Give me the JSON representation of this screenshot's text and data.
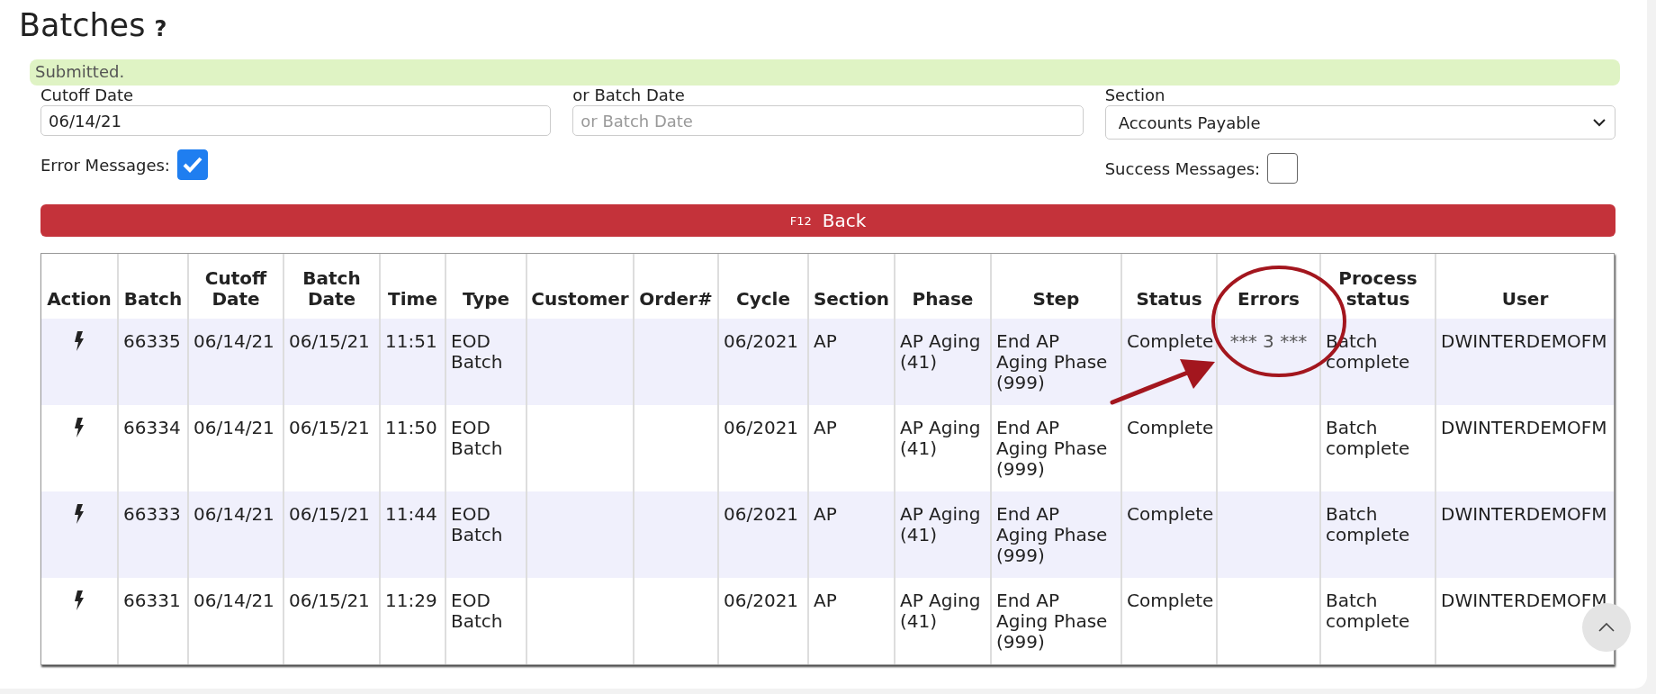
{
  "page": {
    "title": "Batches",
    "help": "?"
  },
  "notice": "Submitted.",
  "filters": {
    "cutoff_date": {
      "label": "Cutoff Date",
      "value": "06/14/21"
    },
    "batch_date": {
      "label": "or Batch Date",
      "placeholder": "or Batch Date"
    },
    "section": {
      "label": "Section",
      "value": "Accounts Payable"
    },
    "error_messages": {
      "label": "Error Messages:",
      "checked": true
    },
    "success_messages": {
      "label": "Success Messages:",
      "checked": false
    }
  },
  "back_button": {
    "key": "F12",
    "label": "Back"
  },
  "table": {
    "columns": [
      "Action",
      "Batch",
      "Cutoff Date",
      "Batch Date",
      "Time",
      "Type",
      "Customer",
      "Order#",
      "Cycle",
      "Section",
      "Phase",
      "Step",
      "Status",
      "Errors",
      "Process status",
      "User"
    ],
    "rows": [
      {
        "batch": "66335",
        "cutoff_date": "06/14/21",
        "batch_date": "06/15/21",
        "time": "11:51",
        "type": "EOD Batch",
        "customer": "",
        "order": "",
        "cycle": "06/2021",
        "section": "AP",
        "phase": "AP Aging (41)",
        "step": "End AP Aging Phase (999)",
        "status": "Complete",
        "errors": "*** 3 ***",
        "process_status": "Batch complete",
        "user": "DWINTERDEMOFM"
      },
      {
        "batch": "66334",
        "cutoff_date": "06/14/21",
        "batch_date": "06/15/21",
        "time": "11:50",
        "type": "EOD Batch",
        "customer": "",
        "order": "",
        "cycle": "06/2021",
        "section": "AP",
        "phase": "AP Aging (41)",
        "step": "End AP Aging Phase (999)",
        "status": "Complete",
        "errors": "",
        "process_status": "Batch complete",
        "user": "DWINTERDEMOFM"
      },
      {
        "batch": "66333",
        "cutoff_date": "06/14/21",
        "batch_date": "06/15/21",
        "time": "11:44",
        "type": "EOD Batch",
        "customer": "",
        "order": "",
        "cycle": "06/2021",
        "section": "AP",
        "phase": "AP Aging (41)",
        "step": "End AP Aging Phase (999)",
        "status": "Complete",
        "errors": "",
        "process_status": "Batch complete",
        "user": "DWINTERDEMOFM"
      },
      {
        "batch": "66331",
        "cutoff_date": "06/14/21",
        "batch_date": "06/15/21",
        "time": "11:29",
        "type": "EOD Batch",
        "customer": "",
        "order": "",
        "cycle": "06/2021",
        "section": "AP",
        "phase": "AP Aging (41)",
        "step": "End AP Aging Phase (999)",
        "status": "Complete",
        "errors": "",
        "process_status": "Batch complete",
        "user": "DWINTERDEMOFM"
      }
    ]
  }
}
